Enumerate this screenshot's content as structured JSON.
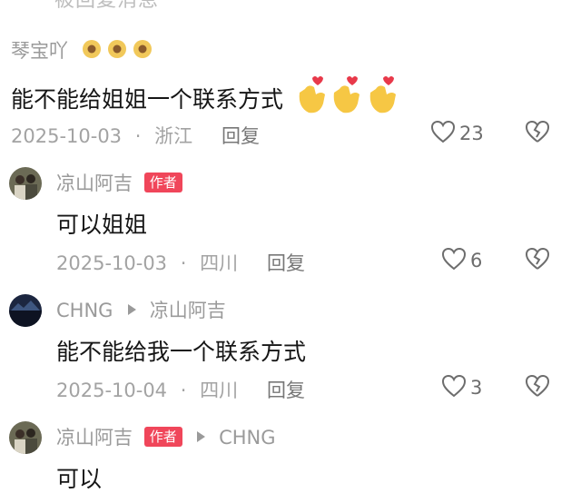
{
  "partial_top": "被回复消息",
  "comments": [
    {
      "username": "琴宝吖",
      "text": "能不能给姐姐一个联系方式",
      "date": "2025-10-03",
      "location": "浙江",
      "reply": "回复",
      "likes": "23"
    },
    {
      "username": "凉山阿吉",
      "badge": "作者",
      "text": "可以姐姐",
      "date": "2025-10-03",
      "location": "四川",
      "reply": "回复",
      "likes": "6"
    },
    {
      "username": "CHNG",
      "reply_to": "凉山阿吉",
      "text": "能不能给我一个联系方式",
      "date": "2025-10-04",
      "location": "四川",
      "reply": "回复",
      "likes": "3"
    },
    {
      "username": "凉山阿吉",
      "badge": "作者",
      "reply_to": "CHNG",
      "text": "可以"
    }
  ],
  "separator": "·",
  "colors": {
    "badge": "#f0465a",
    "meta": "#a3a3a3",
    "name": "#9a9a9a"
  },
  "icons": {
    "like": "heart-outline-icon",
    "dislike": "broken-heart-icon",
    "emoji": "finger-heart-emoji-icon",
    "sunflower": "sunflower-emoji-icon"
  }
}
